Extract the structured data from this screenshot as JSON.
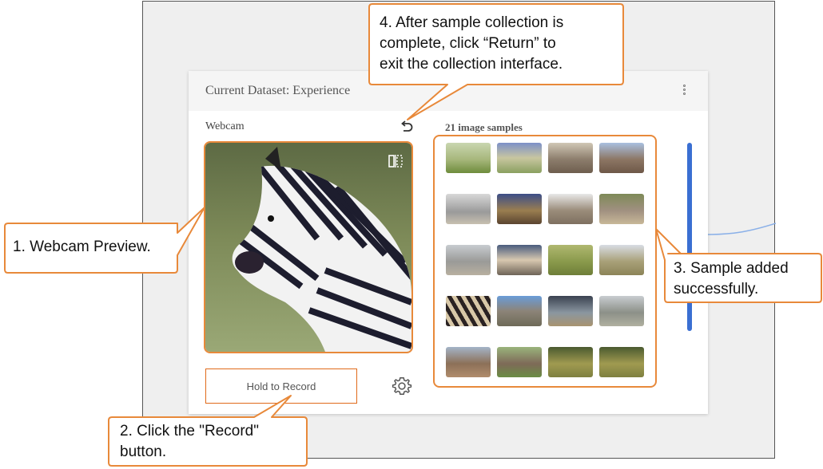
{
  "panel": {
    "title": "Current Dataset: Experience",
    "webcam_label": "Webcam",
    "samples_label": "21 image samples",
    "record_label": "Hold to Record"
  },
  "icons": {
    "menu": "kebab-menu-icon",
    "return": "return-arrow-icon",
    "mirror": "mirror-flip-icon",
    "settings": "gear-icon"
  },
  "callouts": {
    "webcam_preview": "1. Webcam Preview.",
    "record_line1": "2. Click the \"Record\"",
    "record_line2": "button.",
    "sample_line1": "3. Sample added",
    "sample_line2": "successfully.",
    "return_line1": "4. After sample collection is",
    "return_line2": "complete, click “Return” to",
    "return_line3": "exit the collection interface."
  },
  "colors": {
    "callout_border": "#e8893a",
    "record_border": "#e06a1a",
    "scrollbar": "#3a6fd2",
    "panel_header": "#f5f5f5"
  },
  "thumbnails": [
    "zebras-grazing",
    "elephants-at-dusk",
    "elephant-walking",
    "rhino-closeup",
    "rhino-white",
    "zebra-head",
    "elephants-herd",
    "elephant-dusty",
    "rhinos-pair",
    "elephants-spraying",
    "zebra-running",
    "zebras-group",
    "zebra-stripes",
    "elephant-large",
    "savanna-storm",
    "rhinos-standing",
    "elephant-road",
    "elephants-grass",
    "zebras-field",
    "zebras-field-2"
  ]
}
